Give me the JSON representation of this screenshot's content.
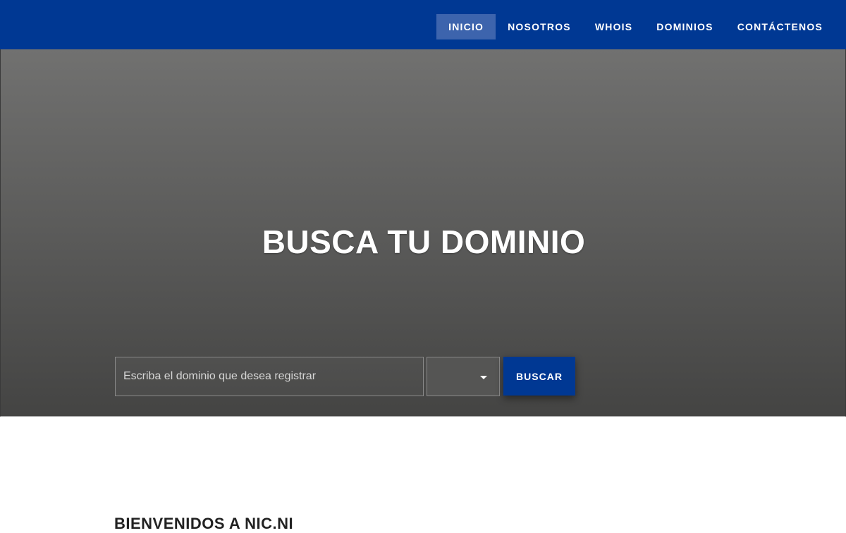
{
  "header": {
    "nav": [
      {
        "label": "INICIO",
        "active": true
      },
      {
        "label": "NOSOTROS",
        "active": false
      },
      {
        "label": "WHOIS",
        "active": false
      },
      {
        "label": "DOMINIOS",
        "active": false
      },
      {
        "label": "CONTÁCTENOS",
        "active": false
      }
    ]
  },
  "hero": {
    "title": "BUSCA TU DOMINIO",
    "search_placeholder": "Escriba el dominio que desea registrar",
    "search_value": "",
    "tld_selected": "",
    "search_button": "BUSCAR"
  },
  "welcome": {
    "heading": "BIENVENIDOS A NIC.NI"
  },
  "colors": {
    "brand_blue": "#003893",
    "nav_active": "#3d64ad"
  },
  "icons": {
    "select_caret": "caret-down-icon"
  }
}
